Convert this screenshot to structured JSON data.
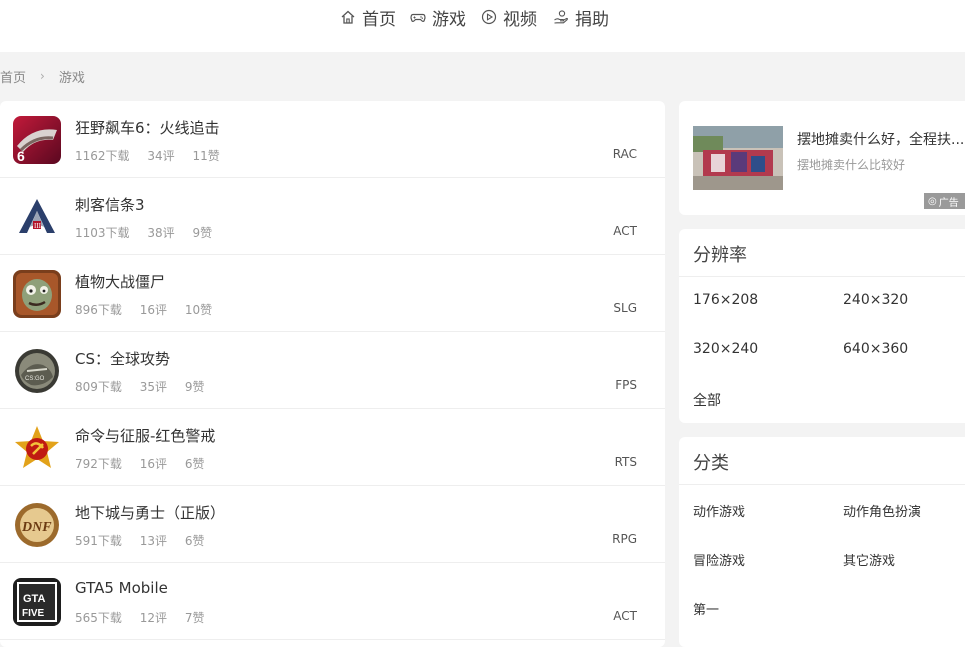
{
  "nav": {
    "items": [
      {
        "label": "首页",
        "icon": "home-icon"
      },
      {
        "label": "游戏",
        "icon": "gamepad-icon"
      },
      {
        "label": "视频",
        "icon": "play-icon"
      },
      {
        "label": "捐助",
        "icon": "donate-hand-icon"
      }
    ]
  },
  "breadcrumb": {
    "home": "首页",
    "separator": "›",
    "current": "游戏"
  },
  "games": [
    {
      "title": "狂野飙车6：火线追击",
      "downloads": "1162下载",
      "reviews": "34评",
      "likes": "11赞",
      "tag": "RAC",
      "icon": "asphalt6-icon"
    },
    {
      "title": "刺客信条3",
      "downloads": "1103下载",
      "reviews": "38评",
      "likes": "9赞",
      "tag": "ACT",
      "icon": "assassins-creed-icon"
    },
    {
      "title": "植物大战僵尸",
      "downloads": "896下载",
      "reviews": "16评",
      "likes": "10赞",
      "tag": "SLG",
      "icon": "zombie-icon"
    },
    {
      "title": "CS：全球攻势",
      "downloads": "809下载",
      "reviews": "35评",
      "likes": "9赞",
      "tag": "FPS",
      "icon": "csgo-icon"
    },
    {
      "title": "命令与征服-红色警戒",
      "downloads": "792下载",
      "reviews": "16评",
      "likes": "6赞",
      "tag": "RTS",
      "icon": "red-alert-icon"
    },
    {
      "title": "地下城与勇士（正版）",
      "downloads": "591下载",
      "reviews": "13评",
      "likes": "6赞",
      "tag": "RPG",
      "icon": "dnf-icon"
    },
    {
      "title": "GTA5 Mobile",
      "downloads": "565下载",
      "reviews": "12评",
      "likes": "7赞",
      "tag": "ACT",
      "icon": "gta5-icon"
    }
  ],
  "ad": {
    "title": "摆地摊卖什么好，全程扶...",
    "subtitle": "摆地摊卖什么比较好",
    "badge": "广告"
  },
  "resolution": {
    "heading": "分辨率",
    "items": [
      "176×208",
      "240×320",
      "320×240",
      "640×360",
      "全部"
    ]
  },
  "category": {
    "heading": "分类",
    "items": [
      "动作游戏",
      "动作角色扮演",
      "冒险游戏",
      "其它游戏",
      "第一"
    ]
  },
  "colors": {
    "background": "#f3f3f3",
    "card": "#ffffff",
    "text": "#333333",
    "muted": "#999999"
  }
}
